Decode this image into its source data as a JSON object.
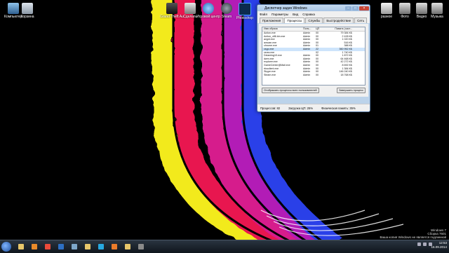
{
  "desktop": {
    "left_icons": [
      {
        "label": "Компьютер",
        "icon": "computer-icon"
      },
      {
        "label": "Корзина",
        "icon": "recycle-bin-icon"
      }
    ],
    "top_icons": [
      {
        "label": "Grand Theft Auto IV Pro",
        "icon": "game-icon"
      },
      {
        "label": "Сделать",
        "icon": "app-icon"
      },
      {
        "label": "Игровой центр@Mail.ru",
        "icon": "game-center-icon"
      },
      {
        "label": "Steam",
        "icon": "steam-icon"
      },
      {
        "label": "Photoshop",
        "icon": "photoshop-icon"
      }
    ],
    "right_icons": [
      {
        "label": "разное",
        "icon": "folder-icon"
      },
      {
        "label": "Фото",
        "icon": "pictures-icon"
      },
      {
        "label": "Видео",
        "icon": "video-icon"
      },
      {
        "label": "Музыка",
        "icon": "music-icon"
      }
    ]
  },
  "taskmanager": {
    "title": "Диспетчер задач Windows",
    "menu": [
      "Файл",
      "Параметры",
      "Вид",
      "Справка"
    ],
    "tabs": [
      "Приложения",
      "Процессы",
      "Службы",
      "Быстродействие",
      "Сеть"
    ],
    "active_tab": 1,
    "columns": [
      "Имя образа",
      "Поль...",
      "ЦП",
      "Память (част..."
    ],
    "processes": [
      {
        "name": "Action.exe",
        "user": "Admin",
        "cpu": "00",
        "mem": "79 384 КБ"
      },
      {
        "name": "Action_x86.bin.exe",
        "user": "Admin",
        "cpu": "00",
        "mem": "2 428 КБ"
      },
      {
        "name": "avgnt.exe",
        "user": "Admin",
        "cpu": "00",
        "mem": "1 020 КБ"
      },
      {
        "name": "avscan.exe",
        "user": "Admin",
        "cpu": "00",
        "mem": "516 КБ"
      },
      {
        "name": "chrome.exe",
        "user": "Admin",
        "cpu": "01",
        "mem": "388 КБ"
      },
      {
        "name": "csgo.exe",
        "user": "Admin",
        "cpu": "22",
        "mem": "360 952 КБ"
      },
      {
        "name": "csrss.exe",
        "user": "",
        "cpu": "02",
        "mem": "1 740 КБ"
      },
      {
        "name": "Dxlaming10.exe",
        "user": "Admin",
        "cpu": "00",
        "mem": "1 872 КБ"
      },
      {
        "name": "dwm.exe",
        "user": "Admin",
        "cpu": "00",
        "mem": "64 468 КБ"
      },
      {
        "name": "explorer.exe",
        "user": "Admin",
        "cpu": "00",
        "mem": "42 272 КБ"
      },
      {
        "name": "GameCenter@Mail.exe",
        "user": "Admin",
        "cpu": "00",
        "mem": "8 692 КБ"
      },
      {
        "name": "rfusclient.exe",
        "user": "Admin",
        "cpu": "00",
        "mem": "1 384 КБ"
      },
      {
        "name": "Skype.exe",
        "user": "Admin",
        "cpu": "00",
        "mem": "146 240 КБ"
      },
      {
        "name": "Steam.exe",
        "user": "Admin",
        "cpu": "00",
        "mem": "18 768 КБ"
      }
    ],
    "selected_index": 5,
    "show_all_button": "Отображать процессы всех пользователей",
    "end_button": "Завершить процесс",
    "status": {
      "processes": "Процессов: 82",
      "cpu": "Загрузка ЦП: 25%",
      "memory": "Физическая память: 35%"
    }
  },
  "watermark": {
    "line1": "Windows 7",
    "line2": "Сборка 7601",
    "line3": "Ваша копия Windows не является подлинной"
  },
  "taskbar": {
    "pinned": [
      "explorer-icon",
      "media-player-icon",
      "chrome-icon",
      "photoshop-icon",
      "monitor-icon",
      "folder-icon",
      "skype-icon",
      "firefox-icon",
      "folder-icon",
      "game-icon"
    ],
    "pinned_colors": [
      "#e7c66a",
      "#e98a2a",
      "#e94a3a",
      "#2d6fc3",
      "#7da6c9",
      "#e7c66a",
      "#27a9e1",
      "#ea7b2a",
      "#e7c66a",
      "#8a8a8a"
    ],
    "clock_time": "12:53",
    "clock_date": "16.09.2014"
  }
}
